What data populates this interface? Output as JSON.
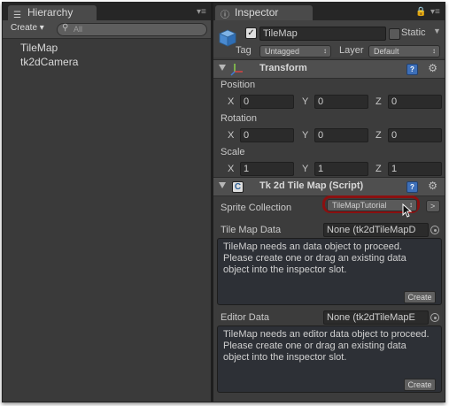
{
  "hierarchy": {
    "tab_label": "Hierarchy",
    "create_label": "Create",
    "search_placeholder": "All",
    "items": [
      {
        "label": "TileMap"
      },
      {
        "label": "tk2dCamera"
      }
    ]
  },
  "inspector": {
    "tab_label": "Inspector",
    "object": {
      "name": "TileMap",
      "static_label": "Static",
      "tag_label": "Tag",
      "tag_value": "Untagged",
      "layer_label": "Layer",
      "layer_value": "Default"
    },
    "transform": {
      "title": "Transform",
      "position_label": "Position",
      "rotation_label": "Rotation",
      "scale_label": "Scale",
      "axis_x": "X",
      "axis_y": "Y",
      "axis_z": "Z",
      "position": {
        "x": "0",
        "y": "0",
        "z": "0"
      },
      "rotation": {
        "x": "0",
        "y": "0",
        "z": "0"
      },
      "scale": {
        "x": "1",
        "y": "1",
        "z": "1"
      }
    },
    "tilemap": {
      "title": "Tk 2d Tile Map (Script)",
      "sprite_collection_label": "Sprite Collection",
      "sprite_collection_value": "TileMapTutorial",
      "goto_button": ">",
      "tile_map_data_label": "Tile Map Data",
      "tile_map_data_value": "None (tk2dTileMapD",
      "tile_map_data_message": "TileMap needs an data object to proceed. Please create one or drag an existing data object into the inspector slot.",
      "create_button": "Create",
      "editor_data_label": "Editor Data",
      "editor_data_value": "None (tk2dTileMapE",
      "editor_data_message": "TileMap needs an editor data object to proceed. Please create one or drag an existing data object into the inspector slot."
    }
  },
  "colors": {
    "panel_bg": "#3c3c3c",
    "header_bg": "#4f4f4f",
    "highlight_ring": "#8b1010",
    "help_blue": "#3d6fb8"
  }
}
